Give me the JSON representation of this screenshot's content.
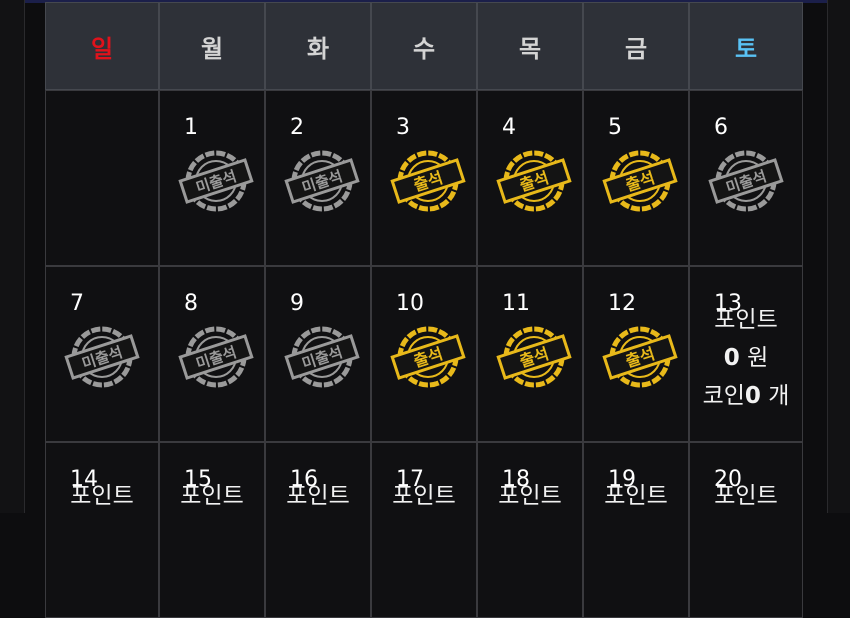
{
  "weekdays": [
    "일",
    "월",
    "화",
    "수",
    "목",
    "금",
    "토"
  ],
  "weekday_colors": {
    "sunday": "#e0121b",
    "saturday": "#59c2f5",
    "default": "#d4d4d4"
  },
  "stamp_labels": {
    "present": "출석",
    "absent": "미출석"
  },
  "stamp_colors": {
    "present": "#e8b91a",
    "absent": "#9a9a9a"
  },
  "days": [
    {
      "day": ""
    },
    {
      "day": "1",
      "status": "absent"
    },
    {
      "day": "2",
      "status": "absent"
    },
    {
      "day": "3",
      "status": "present"
    },
    {
      "day": "4",
      "status": "present"
    },
    {
      "day": "5",
      "status": "present"
    },
    {
      "day": "6",
      "status": "absent"
    },
    {
      "day": "7",
      "status": "absent"
    },
    {
      "day": "8",
      "status": "absent"
    },
    {
      "day": "9",
      "status": "absent"
    },
    {
      "day": "10",
      "status": "present"
    },
    {
      "day": "11",
      "status": "present"
    },
    {
      "day": "12",
      "status": "present"
    },
    {
      "day": "13",
      "status": "info",
      "point_label": "포인트",
      "point_value": "0",
      "point_unit": "원",
      "coin_label": "코인",
      "coin_value": "0",
      "coin_unit": "개"
    },
    {
      "day": "14",
      "status": "info",
      "point_label": "포인트"
    },
    {
      "day": "15",
      "status": "info",
      "point_label": "포인트"
    },
    {
      "day": "16",
      "status": "info",
      "point_label": "포인트"
    },
    {
      "day": "17",
      "status": "info",
      "point_label": "포인트"
    },
    {
      "day": "18",
      "status": "info",
      "point_label": "포인트"
    },
    {
      "day": "19",
      "status": "info",
      "point_label": "포인트"
    },
    {
      "day": "20",
      "status": "info",
      "point_label": "포인트"
    }
  ]
}
